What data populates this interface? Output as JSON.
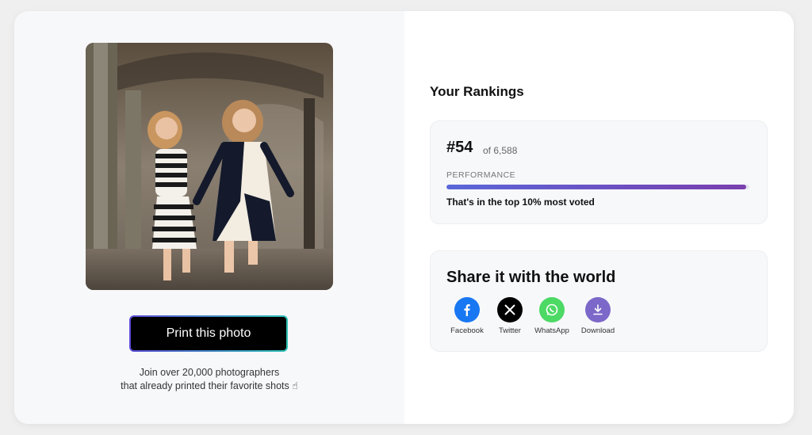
{
  "photo": {
    "alt": "Two girls running and laughing in an arched corridor"
  },
  "print_button": {
    "label": "Print this photo"
  },
  "join_text": {
    "line1": "Join over 20,000 photographers",
    "line2": "that already printed their favorite shots ☝"
  },
  "rankings": {
    "title": "Your Rankings",
    "rank": "#54",
    "of": "of 6,588",
    "performance_label": "PERFORMANCE",
    "performance_fraction": 0.99,
    "performance_text": "That's in the top 10% most voted"
  },
  "share": {
    "title": "Share it with the world",
    "items": [
      {
        "label": "Facebook",
        "icon": "facebook-icon",
        "color": "#1877f2"
      },
      {
        "label": "Twitter",
        "icon": "x-icon",
        "color": "#000000"
      },
      {
        "label": "WhatsApp",
        "icon": "whatsapp-icon",
        "color": "#4cd964"
      },
      {
        "label": "Download",
        "icon": "download-icon",
        "color": "#7b68c8"
      }
    ]
  }
}
